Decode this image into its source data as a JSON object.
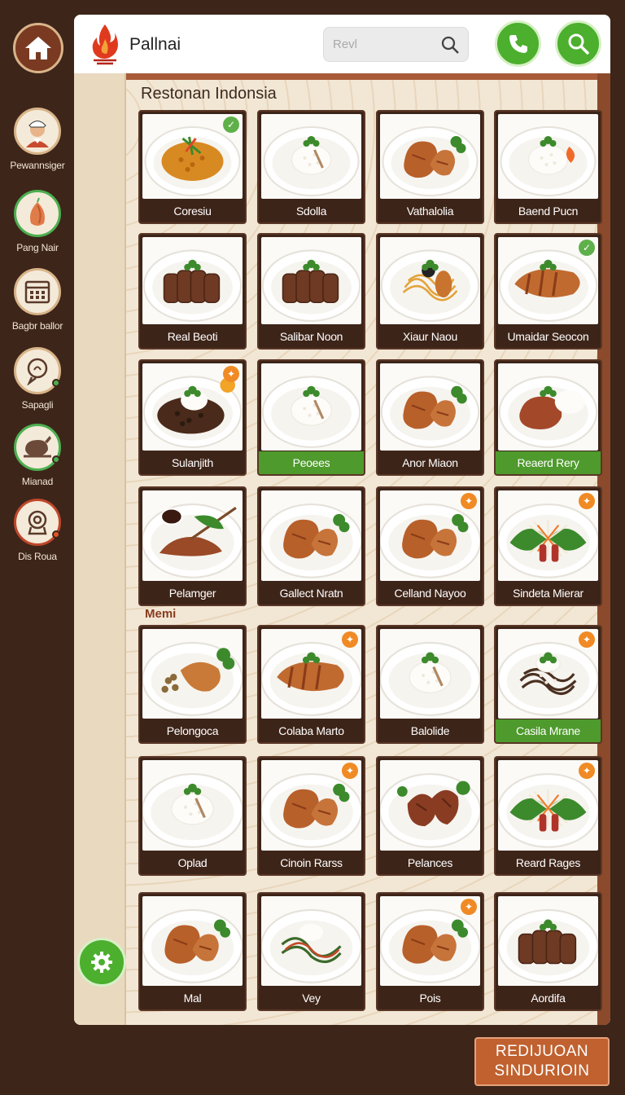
{
  "app": {
    "title": "Pallnai"
  },
  "search": {
    "placeholder": "Revl"
  },
  "sidebar": {
    "items": [
      {
        "label": "Pewannsiger",
        "icon": "chef-avatar-icon"
      },
      {
        "label": "Pang Nair",
        "icon": "onion-icon"
      },
      {
        "label": "Bagbr ballor",
        "icon": "calendar-icon"
      },
      {
        "label": "Sapagli",
        "icon": "chat-support-icon"
      },
      {
        "label": "Mianad",
        "icon": "roast-chicken-icon"
      },
      {
        "label": "Dis Roua",
        "icon": "location-pin-icon"
      }
    ]
  },
  "main": {
    "section_title": "Restonan Indonsia",
    "section_sub": "Memi",
    "menu_items": [
      {
        "name": "Coresiu",
        "dish": "orange-rice",
        "badge": "check"
      },
      {
        "name": "Sdolla",
        "dish": "white-rice"
      },
      {
        "name": "Vathalolia",
        "dish": "chicken"
      },
      {
        "name": "Baend Pucn",
        "dish": "white-rice-carrot"
      },
      {
        "name": "Real Beoti",
        "dish": "sliced-meat"
      },
      {
        "name": "Salibar Noon",
        "dish": "sliced-meat"
      },
      {
        "name": "Xiaur Naou",
        "dish": "noodles"
      },
      {
        "name": "Umaidar Seocon",
        "dish": "grilled-fish",
        "badge": "check"
      },
      {
        "name": "Sulanjith",
        "dish": "beans-rice",
        "badge": "spice"
      },
      {
        "name": "Peoees",
        "dish": "white-rice",
        "green": true
      },
      {
        "name": "Anor Miaon",
        "dish": "chicken"
      },
      {
        "name": "Reaerd Rery",
        "dish": "meat-rice",
        "green": true
      },
      {
        "name": "Pelamger",
        "dish": "skewer"
      },
      {
        "name": "Gallect Nratn",
        "dish": "chicken"
      },
      {
        "name": "Celland Nayoo",
        "dish": "chicken",
        "badge": "spice"
      },
      {
        "name": "Sindeta Mierar",
        "dish": "salad",
        "badge": "spice"
      },
      {
        "name": "Pelongoca",
        "dish": "chicken-beans"
      },
      {
        "name": "Colaba Marto",
        "dish": "grilled-fish",
        "badge": "spice"
      },
      {
        "name": "Balolide",
        "dish": "white-rice"
      },
      {
        "name": "Casila Mrane",
        "dish": "noodles-dark",
        "badge": "spice",
        "green": true
      },
      {
        "name": "Oplad",
        "dish": "white-rice"
      },
      {
        "name": "Cinoin Rarss",
        "dish": "chicken",
        "badge": "spice"
      },
      {
        "name": "Pelances",
        "dish": "sausage"
      },
      {
        "name": "Reard Rages",
        "dish": "salad",
        "badge": "spice"
      },
      {
        "name": "Mal",
        "dish": "chicken"
      },
      {
        "name": "Vey",
        "dish": "noodles-green"
      },
      {
        "name": "Pois",
        "dish": "chicken",
        "badge": "spice"
      },
      {
        "name": "Aordifa",
        "dish": "sliced-meat"
      }
    ]
  },
  "footer": {
    "button_line1": "REDIJUOAN",
    "button_line2": "SINDURIOIN"
  },
  "colors": {
    "accent_green": "#4caf2e",
    "brown": "#3d251a",
    "caption_bg": "#3d2418",
    "brand_red": "#e03a1e"
  }
}
